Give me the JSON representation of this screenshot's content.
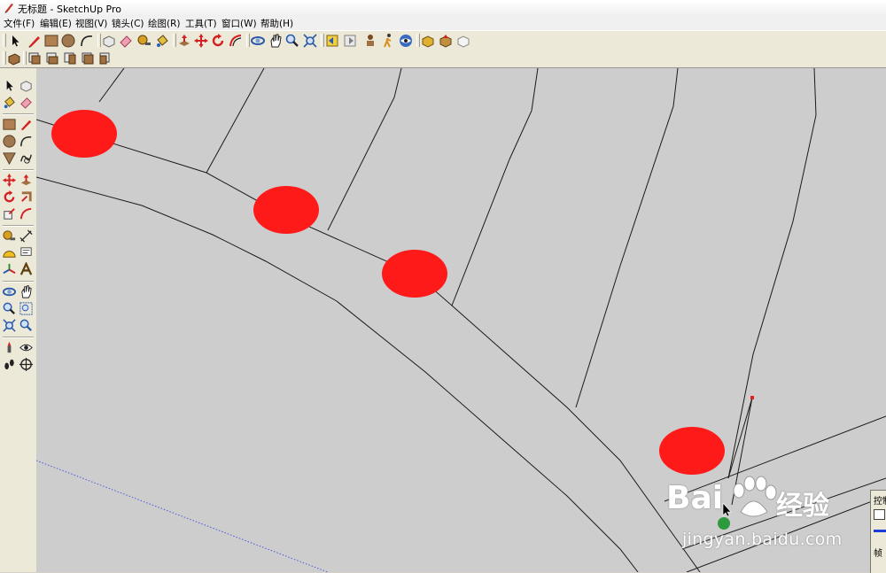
{
  "window": {
    "title": "无标题 - SketchUp Pro"
  },
  "menubar": {
    "items": [
      {
        "label": "文件(F)"
      },
      {
        "label": "编辑(E)"
      },
      {
        "label": "视图(V)"
      },
      {
        "label": "镜头(C)"
      },
      {
        "label": "绘图(R)"
      },
      {
        "label": "工具(T)"
      },
      {
        "label": "窗口(W)"
      },
      {
        "label": "帮助(H)"
      }
    ]
  },
  "toolbar_main": {
    "icons": [
      "select-icon",
      "pencil-icon",
      "rectangle-icon",
      "circle-icon",
      "arc-icon",
      "make-component-icon",
      "eraser-icon",
      "tape-measure-icon",
      "paint-bucket-icon",
      "push-pull-icon",
      "move-icon",
      "rotate-icon",
      "offset-icon",
      "orbit-icon",
      "pan-icon",
      "zoom-icon",
      "zoom-extents-icon",
      "previous-view-icon",
      "next-view-icon",
      "position-camera-icon",
      "walk-icon",
      "look-around-icon",
      "get-models-icon",
      "share-model-icon",
      "share-component-icon"
    ]
  },
  "toolbar_views": {
    "icons": [
      "iso-view-icon",
      "top-view-icon",
      "front-view-icon",
      "right-view-icon",
      "back-view-icon",
      "left-view-icon"
    ]
  },
  "sidebar": {
    "icons": [
      "select-icon",
      "make-component-icon",
      "paint-bucket-icon",
      "eraser-icon",
      "rectangle-icon",
      "pencil-icon",
      "circle-icon",
      "arc-icon",
      "polygon-icon",
      "freehand-icon",
      "move-icon",
      "push-pull-icon",
      "rotate-icon",
      "follow-me-icon",
      "scale-icon",
      "offset-icon",
      "tape-measure-icon",
      "dimension-icon",
      "protractor-icon",
      "text-icon",
      "axes-icon",
      "3d-text-icon",
      "orbit-icon",
      "pan-icon",
      "zoom-icon",
      "zoom-window-icon",
      "zoom-extents-icon",
      "previous-view-icon",
      "position-camera-icon",
      "look-around-icon",
      "walk-icon",
      "section-plane-icon"
    ]
  },
  "canvas": {
    "background": "#cdcdcd",
    "marker_color": "#ff1a1a",
    "markers_count_label": ""
  },
  "controls_panel": {
    "title": "控制",
    "frame_label": "帧"
  },
  "watermark": {
    "brand_left": "Bai",
    "brand_right": "经验",
    "url": "jingyan.baidu.com"
  }
}
